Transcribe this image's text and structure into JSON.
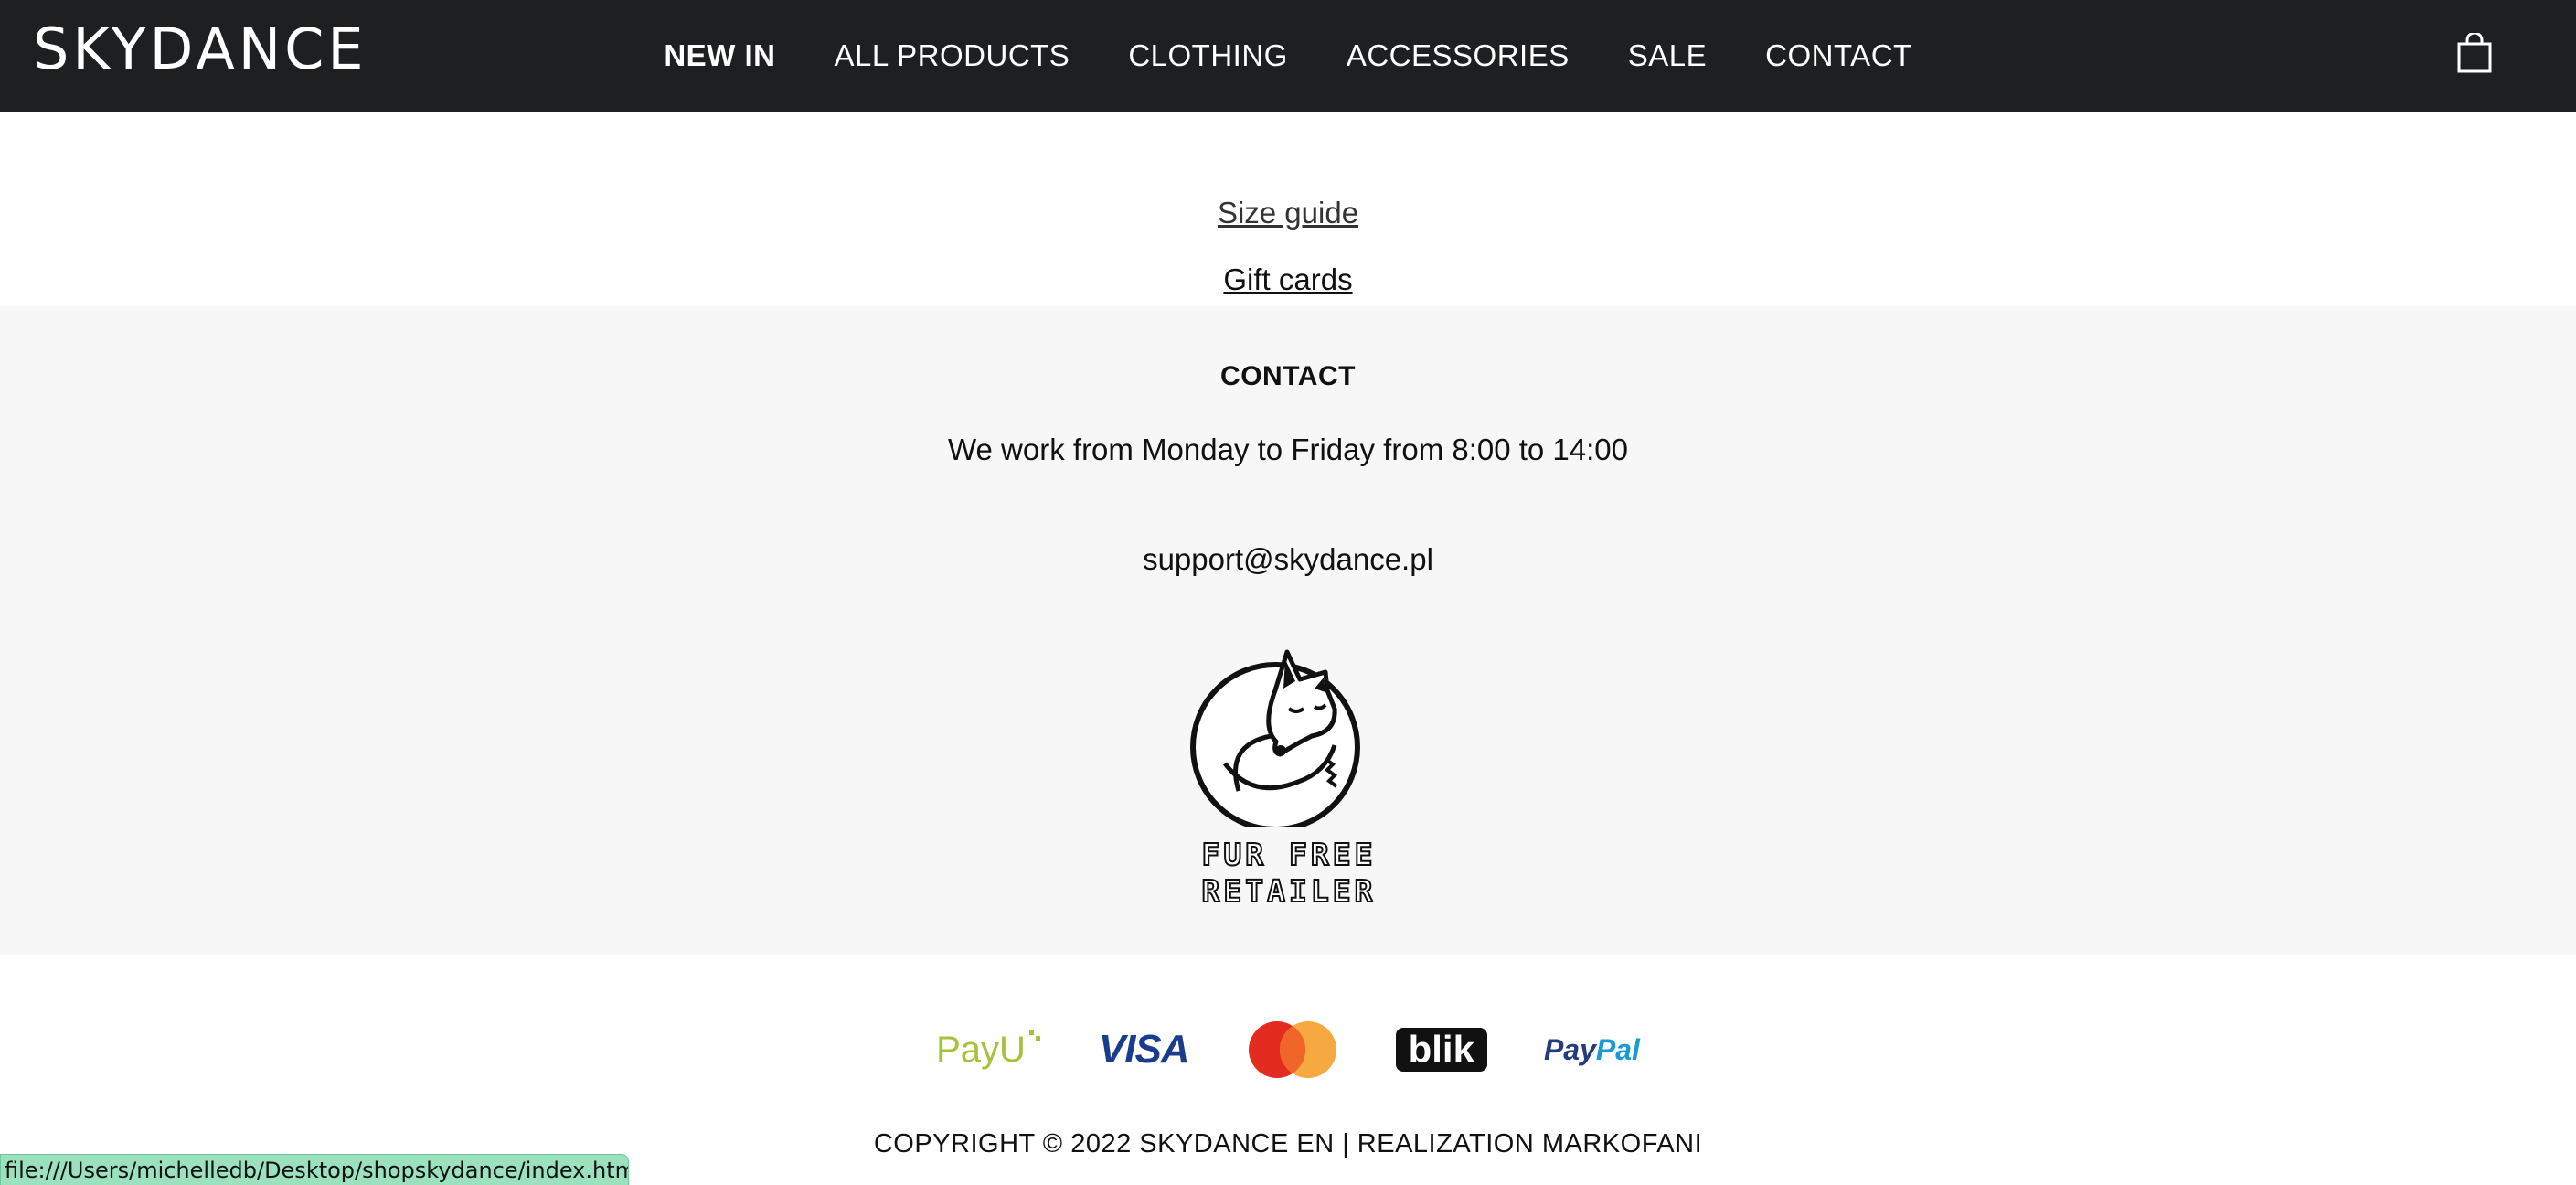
{
  "header": {
    "logo_text": "SKYDANCE",
    "nav": [
      {
        "label": "NEW IN"
      },
      {
        "label": "ALL PRODUCTS"
      },
      {
        "label": "CLOTHING"
      },
      {
        "label": "ACCESSORIES"
      },
      {
        "label": "SALE"
      },
      {
        "label": "CONTACT"
      }
    ],
    "cart_icon": "shopping-bag-icon",
    "colors": {
      "background": "#1e1f20",
      "text": "#ffffff"
    }
  },
  "links": {
    "size_guide": "Size guide",
    "gift_cards": "Gift cards"
  },
  "contact": {
    "title": "CONTACT",
    "hours": "We work from Monday to Friday from 8:00 to 14:00",
    "email": "support@skydance.pl",
    "badge_line1": "FUR FREE",
    "badge_line2": "RETAILER",
    "background": "#f7f7f7"
  },
  "payments": {
    "payu": "PayU",
    "visa": "VISA",
    "mastercard_icon": "mastercard-icon",
    "blik": "blik",
    "paypal_1": "Pay",
    "paypal_2": "Pal"
  },
  "footer": {
    "copyright": "COPYRIGHT © 2022 SKYDANCE EN | REALIZATION MARKOFANI"
  },
  "status_bar": {
    "url": "file:///Users/michelledb/Desktop/shopskydance/index.html#"
  }
}
